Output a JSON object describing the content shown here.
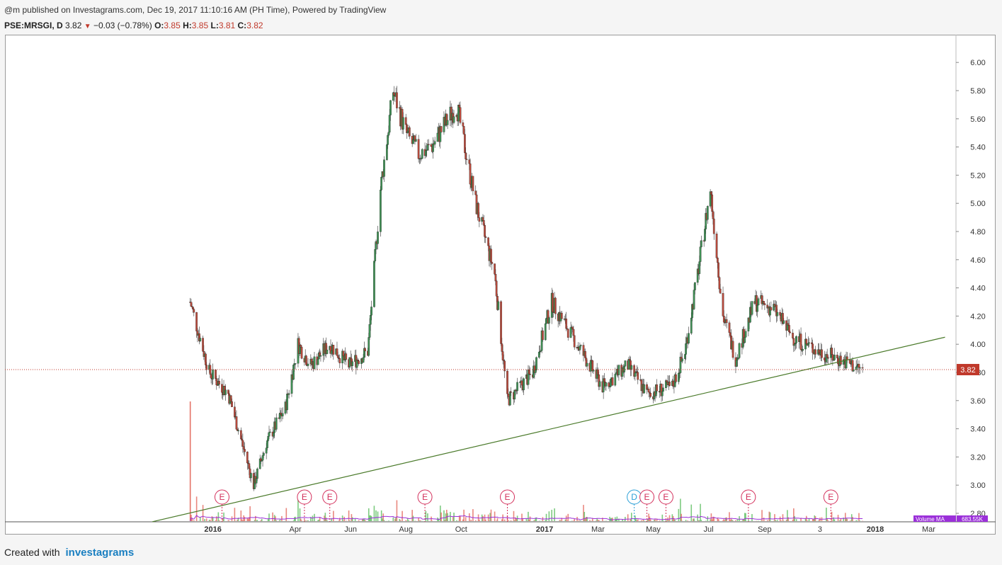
{
  "header": {
    "published": "@m published on Investagrams.com, Dec 19, 2017 11:10:16 AM (PH Time), Powered by TradingView",
    "symbol": "PSE:MRSGI, D",
    "last": "3.82",
    "change": "−0.03 (−0.78%)",
    "open_label": "O:",
    "open": "3.85",
    "high_label": "H:",
    "high": "3.85",
    "low_label": "L:",
    "low": "3.81",
    "close_label": "C:",
    "close": "3.82"
  },
  "footer": {
    "created": "Created with",
    "brand": "investagrams"
  },
  "chart_data": {
    "type": "candlestick",
    "symbol": "PSE:MRSGI",
    "interval": "D",
    "y_range": [
      2.75,
      6.2
    ],
    "y_ticks": [
      "6.00",
      "5.80",
      "5.60",
      "5.40",
      "5.20",
      "5.00",
      "4.80",
      "4.60",
      "4.40",
      "4.20",
      "4.00",
      "3.80",
      "3.60",
      "3.40",
      "3.20",
      "3.00",
      "2.80"
    ],
    "x_ticks": [
      "2016",
      "Apr",
      "Jun",
      "Aug",
      "Oct",
      "2017",
      "Mar",
      "May",
      "Jul",
      "Sep",
      "3",
      "2018",
      "Mar"
    ],
    "last_price_label": "3.82",
    "last_price": 3.82,
    "series": [
      {
        "name": "close",
        "x": [
          "2015-12-07",
          "2015-12-28",
          "2016-01-18",
          "2016-02-15",
          "2016-02-29",
          "2016-03-21",
          "2016-04-04",
          "2016-04-18",
          "2016-05-09",
          "2016-05-30",
          "2016-06-20",
          "2016-07-04",
          "2016-07-18",
          "2016-08-01",
          "2016-08-15",
          "2016-08-29",
          "2016-09-26",
          "2016-10-17",
          "2016-11-07",
          "2016-11-21",
          "2016-12-05",
          "2016-12-19",
          "2017-01-09",
          "2017-02-06",
          "2017-03-06",
          "2017-04-03",
          "2017-04-24",
          "2017-05-22",
          "2017-06-05",
          "2017-06-19",
          "2017-07-03",
          "2017-07-17",
          "2017-07-31",
          "2017-08-21",
          "2017-09-11",
          "2017-10-02",
          "2017-10-30",
          "2017-11-20",
          "2017-12-18"
        ],
        "values": [
          4.3,
          3.8,
          3.65,
          3.0,
          3.3,
          3.55,
          4.0,
          3.85,
          4.0,
          3.85,
          3.95,
          5.1,
          5.8,
          5.5,
          5.35,
          5.4,
          5.7,
          5.0,
          4.5,
          3.6,
          3.7,
          3.8,
          4.3,
          4.0,
          3.7,
          3.85,
          3.65,
          3.7,
          3.95,
          4.5,
          5.1,
          4.2,
          3.9,
          4.3,
          4.25,
          4.05,
          3.95,
          3.9,
          3.82
        ]
      }
    ],
    "volume_ma_label": "Volume MA",
    "volume_ma_value": "683.55K",
    "events": [
      {
        "label": "E",
        "date": "2016-01-11"
      },
      {
        "label": "E",
        "date": "2016-04-11"
      },
      {
        "label": "E",
        "date": "2016-05-09"
      },
      {
        "label": "E",
        "date": "2016-08-22"
      },
      {
        "label": "E",
        "date": "2016-11-21"
      },
      {
        "label": "D",
        "date": "2017-04-10"
      },
      {
        "label": "E",
        "date": "2017-04-24"
      },
      {
        "label": "E",
        "date": "2017-05-15"
      },
      {
        "label": "E",
        "date": "2017-08-14"
      },
      {
        "label": "E",
        "date": "2017-11-13"
      }
    ],
    "trendline": {
      "start": {
        "date": "2015-10-26",
        "price": 2.74
      },
      "end": {
        "date": "2018-03-19",
        "price": 4.05
      }
    },
    "colors": {
      "up": "#3f8f54",
      "down": "#b84a3c",
      "trendline": "#4a7a2a",
      "ma": "#9b30d9",
      "last_price": "#c0392b",
      "event_e": "#d32f5b",
      "event_d": "#2a9fd6"
    }
  }
}
